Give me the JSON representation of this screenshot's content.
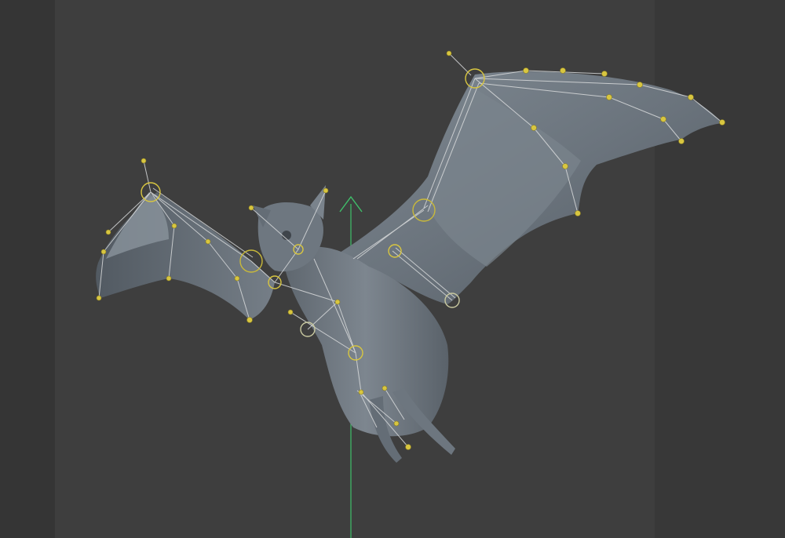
{
  "viewport": {
    "background_color": "#3e3e3e",
    "mode": "pose"
  },
  "colors": {
    "mesh": "#6f7881",
    "mesh_shadow": "#4a5158",
    "mesh_highlight": "#99a2ab",
    "bone_wire": "#d9dbdc",
    "joint_selected": "#d8c640",
    "axis_y": "#3fbf6a"
  },
  "icons": {
    "gizmo": "transform-arrow-icon"
  }
}
